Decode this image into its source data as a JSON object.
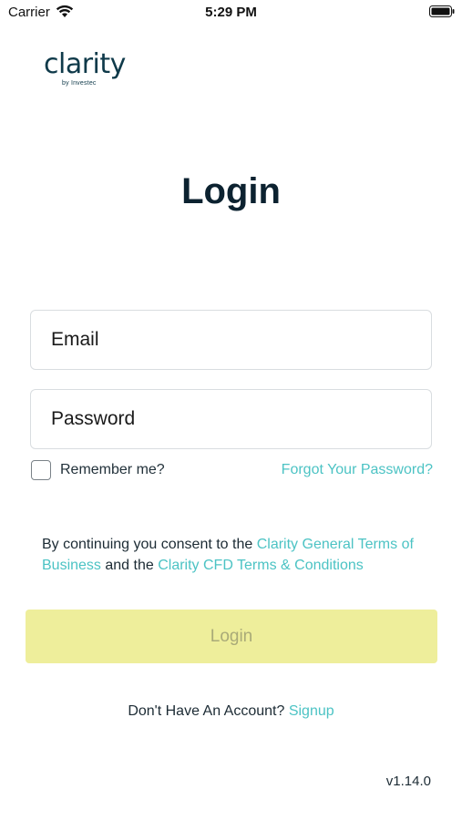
{
  "status_bar": {
    "carrier": "Carrier",
    "time": "5:29 PM"
  },
  "logo": {
    "word": "clarity",
    "sub": "by Investec"
  },
  "title": "Login",
  "form": {
    "email_placeholder": "Email",
    "password_placeholder": "Password",
    "remember_label": "Remember me?",
    "remember_checked": false,
    "forgot_label": "Forgot Your Password?"
  },
  "consent": {
    "prefix": "By continuing you consent to the ",
    "link1": "Clarity General Terms of Business",
    "middle": " and the ",
    "link2": "Clarity CFD Terms & Conditions"
  },
  "login_button": "Login",
  "signup": {
    "prompt": "Don't Have An Account? ",
    "link": "Signup"
  },
  "version": "v1.14.0",
  "colors": {
    "accent": "#4cc3c4",
    "button_bg": "#eeee9b",
    "title": "#0c2230"
  },
  "icons": [
    "wifi-icon",
    "battery-icon"
  ]
}
